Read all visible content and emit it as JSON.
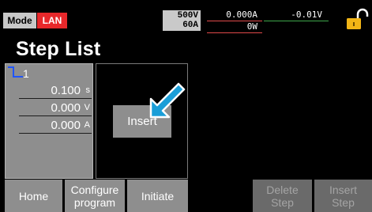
{
  "status_bar": {
    "mode_label": "Mode",
    "lan_label": "LAN",
    "rating_voltage": "500V",
    "rating_current": "60A",
    "current_reading": "0.000A",
    "power_reading": "0W",
    "voltage_reading": "-0.01V",
    "lock_icon": "padlock-icon",
    "colors": {
      "lan_red": "#e8282b",
      "current_underline": "#e04a4a",
      "voltage_underline": "#3fa64a",
      "lock_yellow": "#f2b516"
    }
  },
  "page": {
    "title": "Step List"
  },
  "step": {
    "number": "1",
    "icon": "step-waveform-icon",
    "time_value": "0.100",
    "time_unit": "s",
    "voltage_value": "0.000",
    "voltage_unit": "V",
    "current_value": "0.000",
    "current_unit": "A"
  },
  "insert_panel": {
    "button_label": "Insert",
    "pointer_icon": "pointer-arrow-icon"
  },
  "softkeys": {
    "home": "Home",
    "configure_line1": "Configure",
    "configure_line2": "program",
    "initiate": "Initiate",
    "delete_line1": "Delete",
    "delete_line2": "Step",
    "insert_line1": "Insert",
    "insert_line2": "Step"
  }
}
